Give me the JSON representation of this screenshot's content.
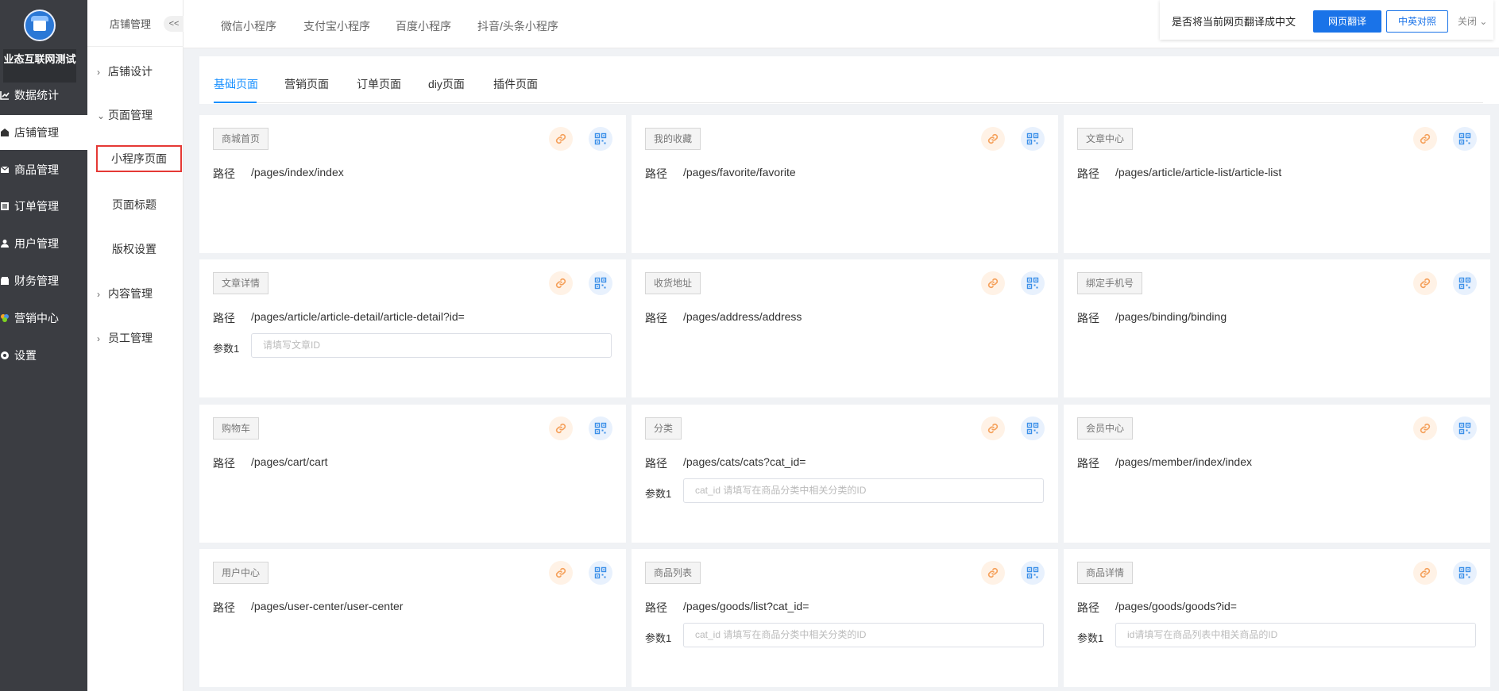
{
  "sidebar": {
    "shop_name": "业态互联网测试",
    "items": [
      {
        "label": "数据统计",
        "icon": "chart-line-icon"
      },
      {
        "label": "店铺管理",
        "icon": "store-icon"
      },
      {
        "label": "商品管理",
        "icon": "mail-icon"
      },
      {
        "label": "订单管理",
        "icon": "list-icon"
      },
      {
        "label": "用户管理",
        "icon": "user-icon"
      },
      {
        "label": "财务管理",
        "icon": "wallet-icon"
      },
      {
        "label": "营销中心",
        "icon": "marketing-icon"
      },
      {
        "label": "设置",
        "icon": "gear-icon"
      }
    ]
  },
  "subnav": {
    "title": "店铺管理",
    "collapse_label": "<<",
    "groups": [
      {
        "label": "店铺设计"
      },
      {
        "label": "页面管理"
      },
      {
        "label": "内容管理"
      },
      {
        "label": "员工管理"
      }
    ],
    "items": [
      {
        "label": "小程序页面"
      },
      {
        "label": "页面标题"
      },
      {
        "label": "版权设置"
      }
    ]
  },
  "topbar": {
    "tabs": [
      {
        "label": "微信小程序"
      },
      {
        "label": "支付宝小程序"
      },
      {
        "label": "百度小程序"
      },
      {
        "label": "抖音/头条小程序"
      }
    ]
  },
  "translate_bar": {
    "prompt": "是否将当前网页翻译成中文",
    "translate_button": "网页翻译",
    "compare_button": "中英对照",
    "close_label": "关闭"
  },
  "page_tabs": [
    {
      "label": "基础页面"
    },
    {
      "label": "营销页面"
    },
    {
      "label": "订单页面"
    },
    {
      "label": "diy页面"
    },
    {
      "label": "插件页面"
    }
  ],
  "path_label": "路径",
  "cards": [
    {
      "name": "商城首页",
      "path": "/pages/index/index"
    },
    {
      "name": "我的收藏",
      "path": "/pages/favorite/favorite"
    },
    {
      "name": "文章中心",
      "path": "/pages/article/article-list/article-list"
    },
    {
      "name": "文章详情",
      "path": "/pages/article/article-detail/article-detail?id=",
      "param_label": "参数1",
      "param_placeholder": "请填写文章ID"
    },
    {
      "name": "收货地址",
      "path": "/pages/address/address"
    },
    {
      "name": "绑定手机号",
      "path": "/pages/binding/binding"
    },
    {
      "name": "购物车",
      "path": "/pages/cart/cart"
    },
    {
      "name": "分类",
      "path": "/pages/cats/cats?cat_id=",
      "param_label": "参数1",
      "param_placeholder": "cat_id 请填写在商品分类中相关分类的ID"
    },
    {
      "name": "会员中心",
      "path": "/pages/member/index/index"
    },
    {
      "name": "用户中心",
      "path": "/pages/user-center/user-center"
    },
    {
      "name": "商品列表",
      "path": "/pages/goods/list?cat_id=",
      "param_label": "参数1",
      "param_placeholder": "cat_id 请填写在商品分类中相关分类的ID"
    },
    {
      "name": "商品详情",
      "path": "/pages/goods/goods?id=",
      "param_label": "参数1",
      "param_placeholder": "id请填写在商品列表中相关商品的ID"
    }
  ],
  "colors": {
    "sidebar_bg": "#3b3d42",
    "accent": "#1890ff",
    "link_icon": "#f5a05a",
    "qr_icon": "#3b8fe8",
    "highlight_border": "#e53935"
  }
}
